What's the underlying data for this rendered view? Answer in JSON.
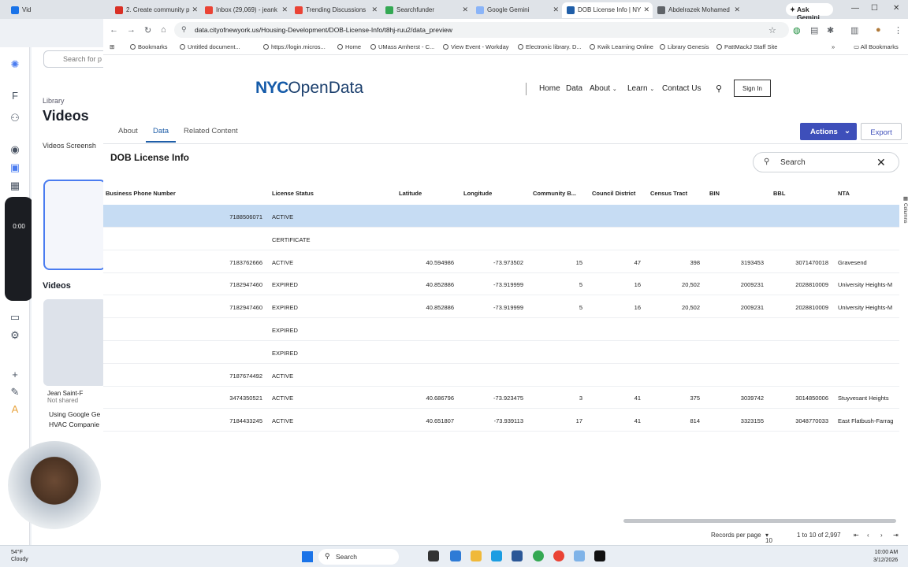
{
  "browser": {
    "tabs": [
      {
        "label": "2. Create community p",
        "color": "#d93025",
        "active": false
      },
      {
        "label": "Inbox (29,069) - jeank",
        "color": "#ea4335",
        "active": false
      },
      {
        "label": "Trending Discussions",
        "color": "#ea4335",
        "active": false
      },
      {
        "label": "Searchfunder",
        "color": "#34a853",
        "active": false
      },
      {
        "label": "Google Gemini",
        "color": "#8ab4f8",
        "active": false
      },
      {
        "label": "DOB License Info | NY",
        "color": "#1f5ea8",
        "active": true
      },
      {
        "label": "Abdelrazek Mohamed",
        "color": "#5f6368",
        "active": false
      }
    ],
    "left_tabs": [
      "Vid"
    ],
    "ask_gemini": "Ask Gemini",
    "url": "data.cityofnewyork.us/Housing-Development/DOB-License-Info/t8hj-ruu2/data_preview",
    "bookmarks": [
      "Bookmarks",
      "Untitled document...",
      "https://login.micros...",
      "Home",
      "UMass Amherst - C...",
      "View Event - Workday",
      "Electronic library. D...",
      "Kwik Learning Online",
      "Library Genesis",
      "PattMackJ Staff Site"
    ],
    "all_bookmarks": "All Bookmarks"
  },
  "background_app": {
    "search_placeholder": "Search for p",
    "library": "Library",
    "title": "Videos",
    "tabs": "Videos  Screensh",
    "section": "Videos",
    "owner": "Jean Saint-F",
    "owner_sub": "Not shared",
    "caption": "Using Google Ge HVAC Companie",
    "timer": "0:00"
  },
  "page": {
    "logo_nyc": "NYC",
    "logo_rest": "OpenData",
    "nav": [
      "Home",
      "Data",
      "About",
      "Learn",
      "Contact Us"
    ],
    "signin": "Sign In",
    "subtabs": [
      "About",
      "Data",
      "Related Content"
    ],
    "actions": "Actions",
    "export": "Export",
    "dataset_title": "DOB License Info",
    "search_placeholder": "Search",
    "columns_label": "Columns",
    "headers": [
      "Business Phone Number",
      "License Status",
      "Latitude",
      "Longitude",
      "Community B...",
      "Council District",
      "Census Tract",
      "BIN",
      "BBL",
      "NTA"
    ],
    "rows": [
      [
        "7188506071",
        "ACTIVE",
        "",
        "",
        "",
        "",
        "",
        "",
        "",
        ""
      ],
      [
        "",
        "CERTIFICATE",
        "",
        "",
        "",
        "",
        "",
        "",
        "",
        ""
      ],
      [
        "7183762666",
        "ACTIVE",
        "40.594986",
        "-73.973502",
        "15",
        "47",
        "398",
        "3193453",
        "3071470018",
        "Gravesend"
      ],
      [
        "7182947460",
        "EXPIRED",
        "40.852886",
        "-73.919999",
        "5",
        "16",
        "20,502",
        "2009231",
        "2028810009",
        "University Heights-M"
      ],
      [
        "7182947460",
        "EXPIRED",
        "40.852886",
        "-73.919999",
        "5",
        "16",
        "20,502",
        "2009231",
        "2028810009",
        "University Heights-M"
      ],
      [
        "",
        "EXPIRED",
        "",
        "",
        "",
        "",
        "",
        "",
        "",
        ""
      ],
      [
        "",
        "EXPIRED",
        "",
        "",
        "",
        "",
        "",
        "",
        "",
        ""
      ],
      [
        "7187674492",
        "ACTIVE",
        "",
        "",
        "",
        "",
        "",
        "",
        "",
        ""
      ],
      [
        "3474350521",
        "ACTIVE",
        "40.686796",
        "-73.923475",
        "3",
        "41",
        "375",
        "3039742",
        "3014850006",
        "Stuyvesant Heights"
      ],
      [
        "7184433245",
        "ACTIVE",
        "40.651807",
        "-73.939113",
        "17",
        "41",
        "814",
        "3323155",
        "3048770033",
        "East Flatbush-Farrag"
      ]
    ],
    "records_per_page_label": "Records per page",
    "records_per_page": "10",
    "range": "1 to 10 of 2,997"
  },
  "taskbar": {
    "weather_temp": "54°F",
    "weather_desc": "Cloudy",
    "search": "Search",
    "time": "10:00 AM",
    "date": "3/12/2026"
  }
}
